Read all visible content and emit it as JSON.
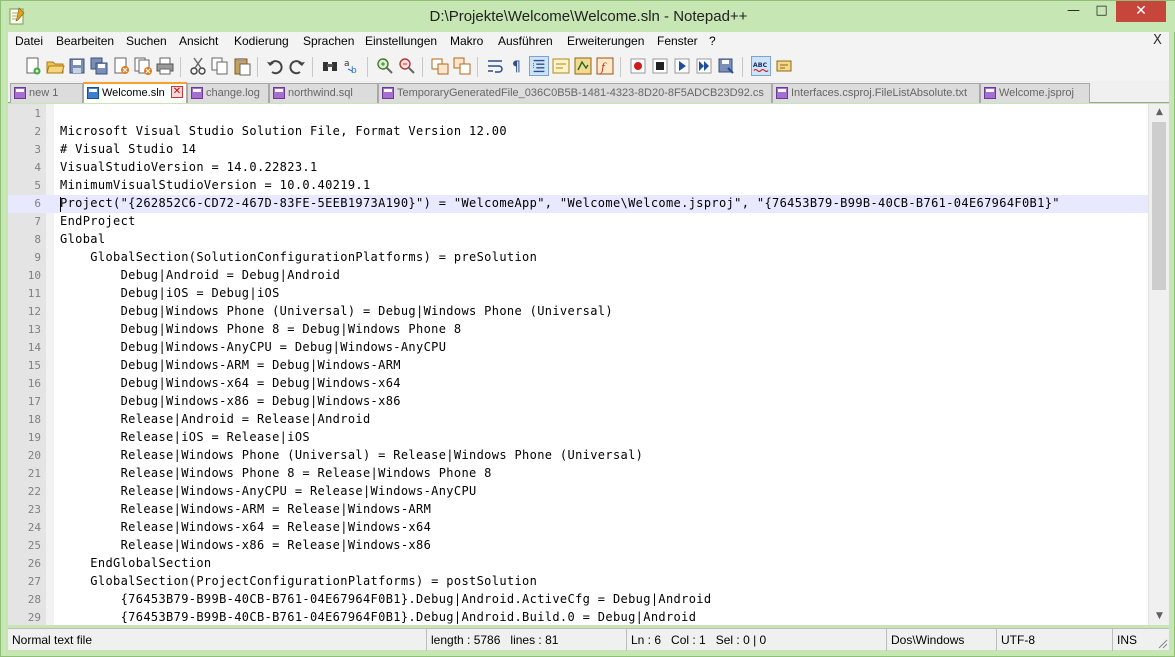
{
  "window": {
    "title": "D:\\Projekte\\Welcome\\Welcome.sln - Notepad++",
    "minimize": "—",
    "maximize": "□",
    "close": "✕"
  },
  "menu": {
    "items": [
      "Datei",
      "Bearbeiten",
      "Suchen",
      "Ansicht",
      "Kodierung",
      "Sprachen",
      "Einstellungen",
      "Makro",
      "Ausführen",
      "Erweiterungen",
      "Fenster",
      "?"
    ],
    "close_doc": "X"
  },
  "toolbar": {
    "buttons": [
      "new-file-icon",
      "open-file-icon",
      "save-icon",
      "save-all-icon",
      "close-icon",
      "close-all-icon",
      "print-icon",
      "cut-icon",
      "copy-icon",
      "paste-icon",
      "undo-icon",
      "redo-icon",
      "find-icon",
      "replace-icon",
      "zoom-in-icon",
      "zoom-out-icon",
      "sync-vertical-icon",
      "sync-horizontal-icon",
      "word-wrap-icon",
      "show-all-chars-icon",
      "indent-guide-icon",
      "user-lang-icon",
      "doc-map-icon",
      "function-list-icon",
      "record-macro-icon",
      "stop-macro-icon",
      "play-macro-icon",
      "run-macro-multiple-icon",
      "save-macro-icon",
      "spellcheck-icon",
      "spellcheck-settings-icon"
    ]
  },
  "tabs": [
    {
      "label": "new  1",
      "active": false,
      "color": "#a56ed0"
    },
    {
      "label": "Welcome.sln",
      "active": true,
      "color": "#3c7fd1"
    },
    {
      "label": "change.log",
      "active": false,
      "color": "#a56ed0"
    },
    {
      "label": "northwind.sql",
      "active": false,
      "color": "#a56ed0"
    },
    {
      "label": "TemporaryGeneratedFile_036C0B5B-1481-4323-8D20-8F5ADCB23D92.cs",
      "active": false,
      "color": "#a56ed0"
    },
    {
      "label": "Interfaces.csproj.FileListAbsolute.txt",
      "active": false,
      "color": "#a56ed0"
    },
    {
      "label": "Welcome.jsproj",
      "active": false,
      "color": "#a56ed0"
    }
  ],
  "editor": {
    "current_line": 6,
    "lines": [
      {
        "n": "1",
        "text": ""
      },
      {
        "n": "2",
        "text": "Microsoft Visual Studio Solution File, Format Version 12.00"
      },
      {
        "n": "3",
        "text": "# Visual Studio 14"
      },
      {
        "n": "4",
        "text": "VisualStudioVersion = 14.0.22823.1"
      },
      {
        "n": "5",
        "text": "MinimumVisualStudioVersion = 10.0.40219.1"
      },
      {
        "n": "6",
        "text": "Project(\"{262852C6-CD72-467D-83FE-5EEB1973A190}\") = \"WelcomeApp\", \"Welcome\\Welcome.jsproj\", \"{76453B79-B99B-40CB-B761-04E67964F0B1}\""
      },
      {
        "n": "7",
        "text": "EndProject"
      },
      {
        "n": "8",
        "text": "Global"
      },
      {
        "n": "9",
        "text": "    GlobalSection(SolutionConfigurationPlatforms) = preSolution"
      },
      {
        "n": "10",
        "text": "        Debug|Android = Debug|Android"
      },
      {
        "n": "11",
        "text": "        Debug|iOS = Debug|iOS"
      },
      {
        "n": "12",
        "text": "        Debug|Windows Phone (Universal) = Debug|Windows Phone (Universal)"
      },
      {
        "n": "13",
        "text": "        Debug|Windows Phone 8 = Debug|Windows Phone 8"
      },
      {
        "n": "14",
        "text": "        Debug|Windows-AnyCPU = Debug|Windows-AnyCPU"
      },
      {
        "n": "15",
        "text": "        Debug|Windows-ARM = Debug|Windows-ARM"
      },
      {
        "n": "16",
        "text": "        Debug|Windows-x64 = Debug|Windows-x64"
      },
      {
        "n": "17",
        "text": "        Debug|Windows-x86 = Debug|Windows-x86"
      },
      {
        "n": "18",
        "text": "        Release|Android = Release|Android"
      },
      {
        "n": "19",
        "text": "        Release|iOS = Release|iOS"
      },
      {
        "n": "20",
        "text": "        Release|Windows Phone (Universal) = Release|Windows Phone (Universal)"
      },
      {
        "n": "21",
        "text": "        Release|Windows Phone 8 = Release|Windows Phone 8"
      },
      {
        "n": "22",
        "text": "        Release|Windows-AnyCPU = Release|Windows-AnyCPU"
      },
      {
        "n": "23",
        "text": "        Release|Windows-ARM = Release|Windows-ARM"
      },
      {
        "n": "24",
        "text": "        Release|Windows-x64 = Release|Windows-x64"
      },
      {
        "n": "25",
        "text": "        Release|Windows-x86 = Release|Windows-x86"
      },
      {
        "n": "26",
        "text": "    EndGlobalSection"
      },
      {
        "n": "27",
        "text": "    GlobalSection(ProjectConfigurationPlatforms) = postSolution"
      },
      {
        "n": "28",
        "text": "        {76453B79-B99B-40CB-B761-04E67964F0B1}.Debug|Android.ActiveCfg = Debug|Android"
      },
      {
        "n": "29",
        "text": "        {76453B79-B99B-40CB-B761-04E67964F0B1}.Debug|Android.Build.0 = Debug|Android"
      }
    ]
  },
  "status": {
    "file_type": "Normal text file",
    "length": "length : 5786",
    "lines": "lines : 81",
    "ln": "Ln : 6",
    "col": "Col : 1",
    "sel": "Sel : 0 | 0",
    "eol": "Dos\\Windows",
    "encoding": "UTF-8",
    "mode": "INS"
  }
}
